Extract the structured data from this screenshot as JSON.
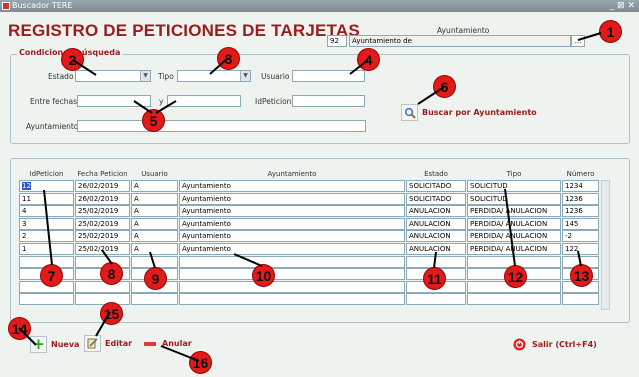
{
  "window": {
    "title": "Buscador TERE",
    "controls": "_ ⊠ ✕"
  },
  "app_title": "REGISTRO DE PETICIONES DE TARJETAS",
  "ayuntamiento_header": {
    "label": "Ayuntamiento",
    "code": "92",
    "name": "Ayuntamiento de",
    "lookup": "..."
  },
  "search": {
    "group_title": "Condiciones búsqueda",
    "estado_label": "Estado",
    "tipo_label": "Tipo",
    "usuario_label": "Usuario",
    "entre_fechas_label": "Entre fechas",
    "y_label": "y",
    "idpeticion_label": "IdPeticion",
    "ayuntamiento_label": "Ayuntamiento",
    "search_button": "Buscar por  Ayuntamiento"
  },
  "table": {
    "columns": [
      "IdPeticion",
      "Fecha Peticion",
      "Usuario",
      "Ayuntamiento",
      "Estado",
      "Tipo",
      "Número"
    ],
    "rows": [
      [
        "12",
        "26/02/2019",
        "A",
        "Ayuntamiento",
        "SOLICITADO",
        "SOLICITUD",
        "1234"
      ],
      [
        "11",
        "26/02/2019",
        "A",
        "Ayuntamiento",
        "SOLICITADO",
        "SOLICITUD",
        "1236"
      ],
      [
        "4",
        "25/02/2019",
        "A",
        "Ayuntamiento",
        "ANULACION",
        "PERDIDA/ ANULACION",
        "1236"
      ],
      [
        "3",
        "25/02/2019",
        "A",
        "Ayuntamiento",
        "ANULACION",
        "PERDIDA/ ANULACION",
        "145"
      ],
      [
        "2",
        "25/02/2019",
        "A",
        "Ayuntamiento",
        "ANULACION",
        "PERDIDA/ ANULACION",
        "-2"
      ],
      [
        "1",
        "25/02/2019",
        "A",
        "Ayuntamiento",
        "ANULACION",
        "PERDIDA/ ANULACION",
        "122"
      ],
      [
        "",
        "",
        "",
        "",
        "",
        "",
        ""
      ],
      [
        "",
        "",
        "",
        "",
        "",
        "",
        ""
      ],
      [
        "",
        "",
        "",
        "",
        "",
        "",
        ""
      ],
      [
        "",
        "",
        "",
        "",
        "",
        "",
        ""
      ]
    ]
  },
  "actions": {
    "nueva": "Nueva",
    "editar": "Editar",
    "anular": "Anular",
    "salir": "Salir (Ctrl+F4)"
  },
  "callouts": [
    "1",
    "2",
    "3",
    "4",
    "5",
    "6",
    "7",
    "8",
    "9",
    "10",
    "11",
    "12",
    "13",
    "14",
    "15",
    "16"
  ],
  "colors": {
    "accent": "#9b1c1c",
    "callout": "#e21a1a",
    "background": "#eef3ef",
    "selection": "#2b58c6"
  }
}
